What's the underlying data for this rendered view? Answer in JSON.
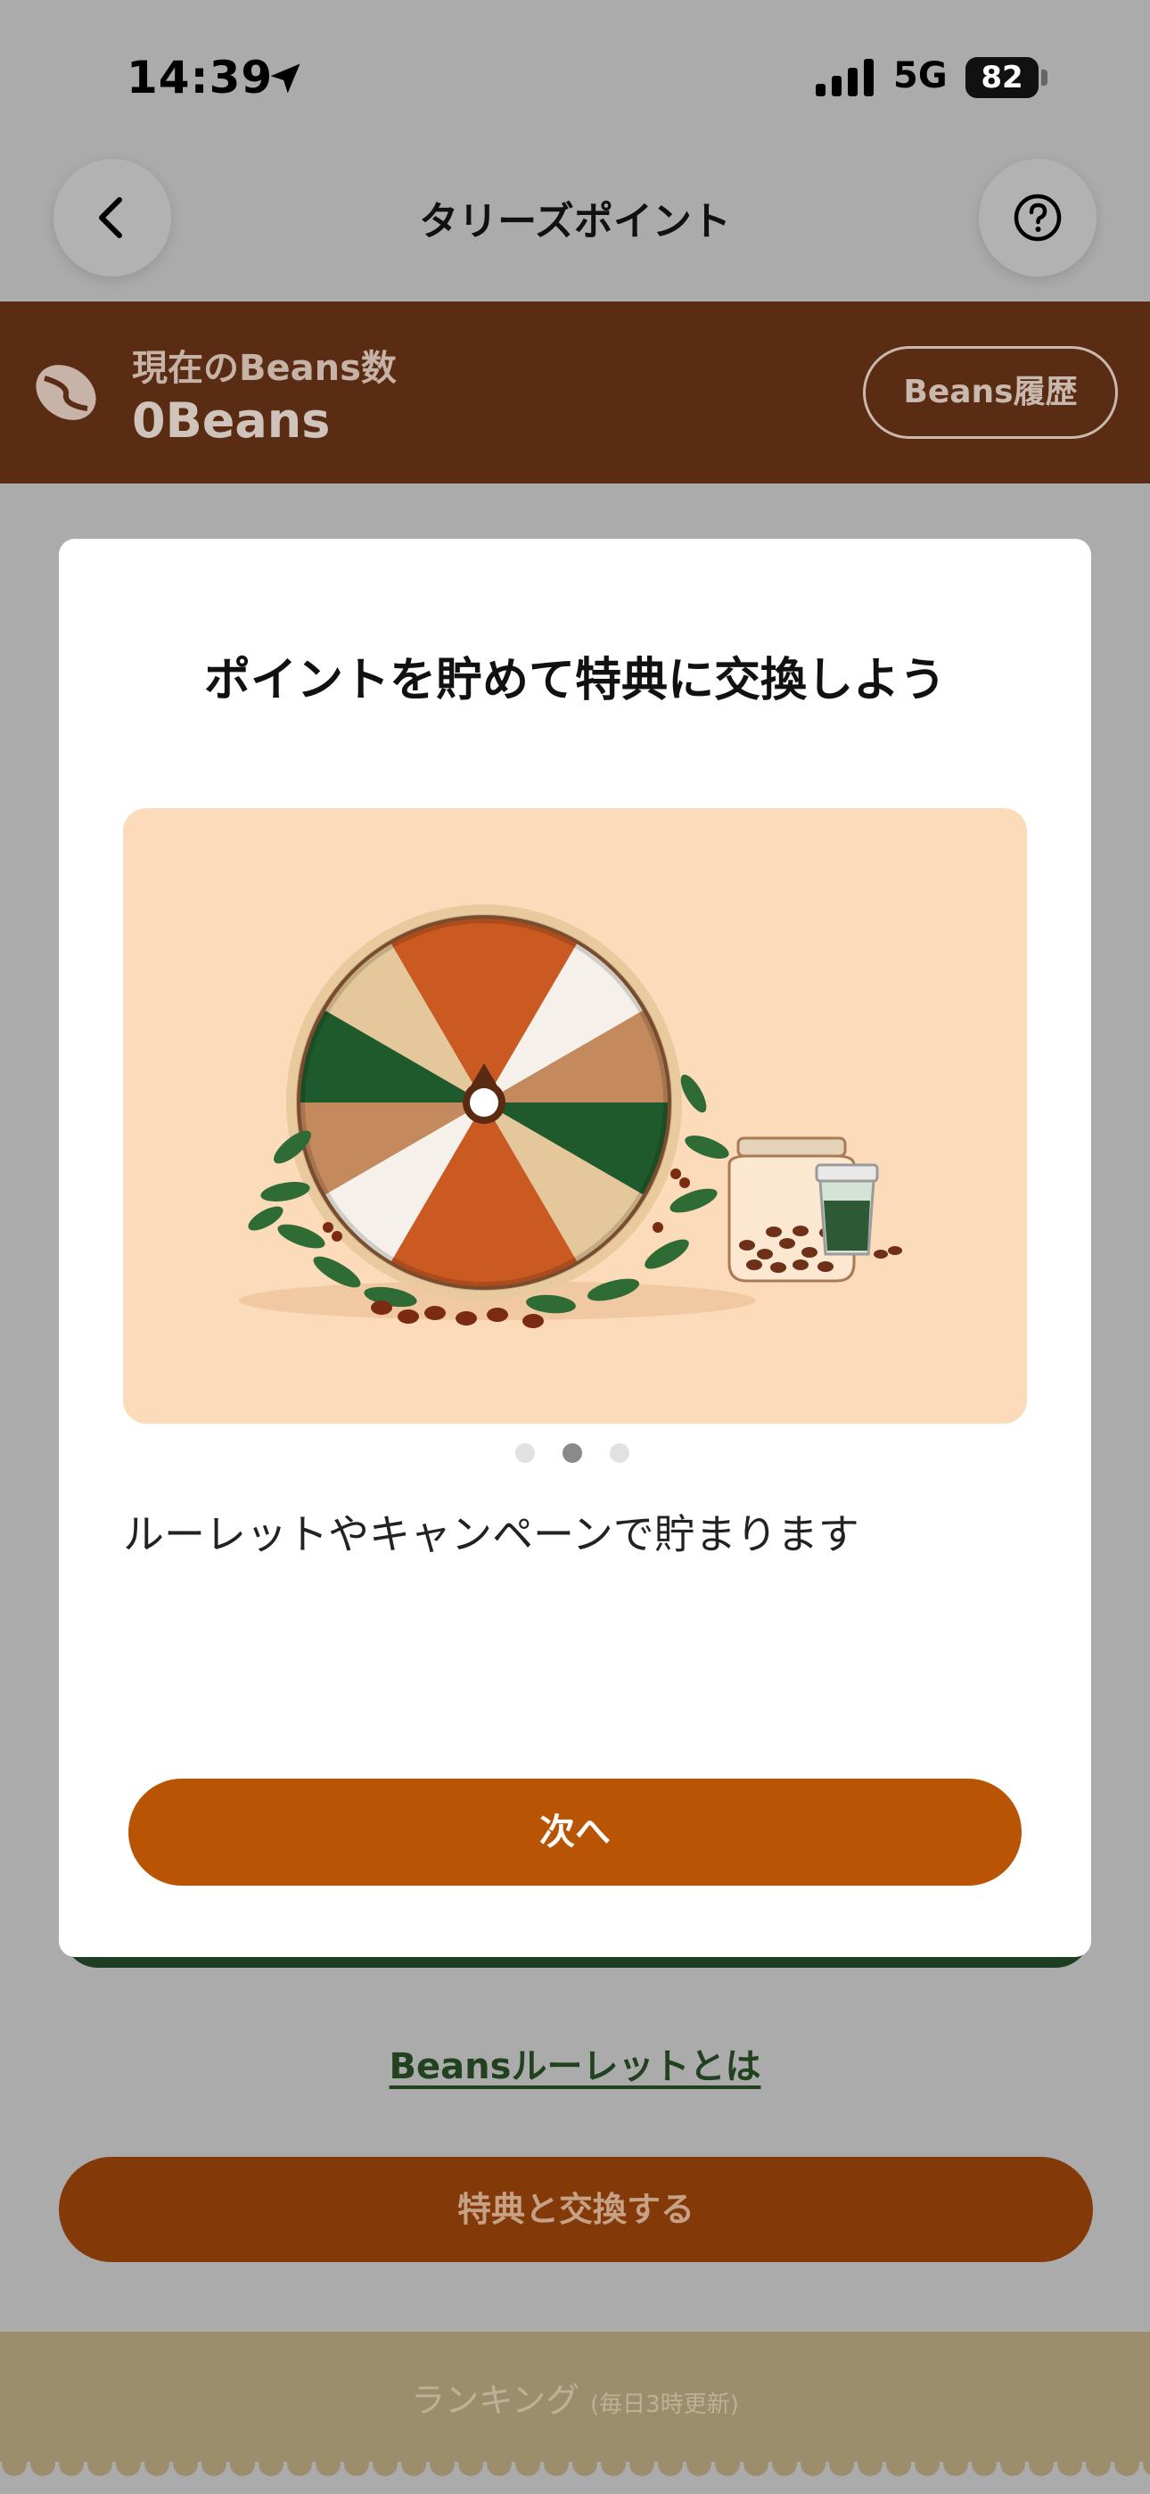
{
  "status_bar": {
    "time": "14:39",
    "network": "5G",
    "battery": "82"
  },
  "header": {
    "title": "タリーズポイント",
    "back_icon": "chevron-left-icon",
    "help_icon": "question-circle-icon"
  },
  "beans": {
    "label": "現在のBeans数",
    "value": "0Beans",
    "history_button": "Beans履歴"
  },
  "modal": {
    "title": "ポイントを貯めて特典に交換しよう",
    "description": "ルーレットやキャンペーンで貯まります",
    "page_indicator": {
      "total": 3,
      "current": 2
    },
    "next_button": "次へ"
  },
  "background": {
    "roulette_link": "Beansルーレットとは",
    "exchange_button": "特典と交換する",
    "ranking_label": "ランキング",
    "ranking_note": "(毎日3時更新)"
  },
  "colors": {
    "brand_brown": "#592c13",
    "accent_orange": "#b85404",
    "illustration_bg": "#fbdbb9",
    "green": "#1e3e21"
  }
}
